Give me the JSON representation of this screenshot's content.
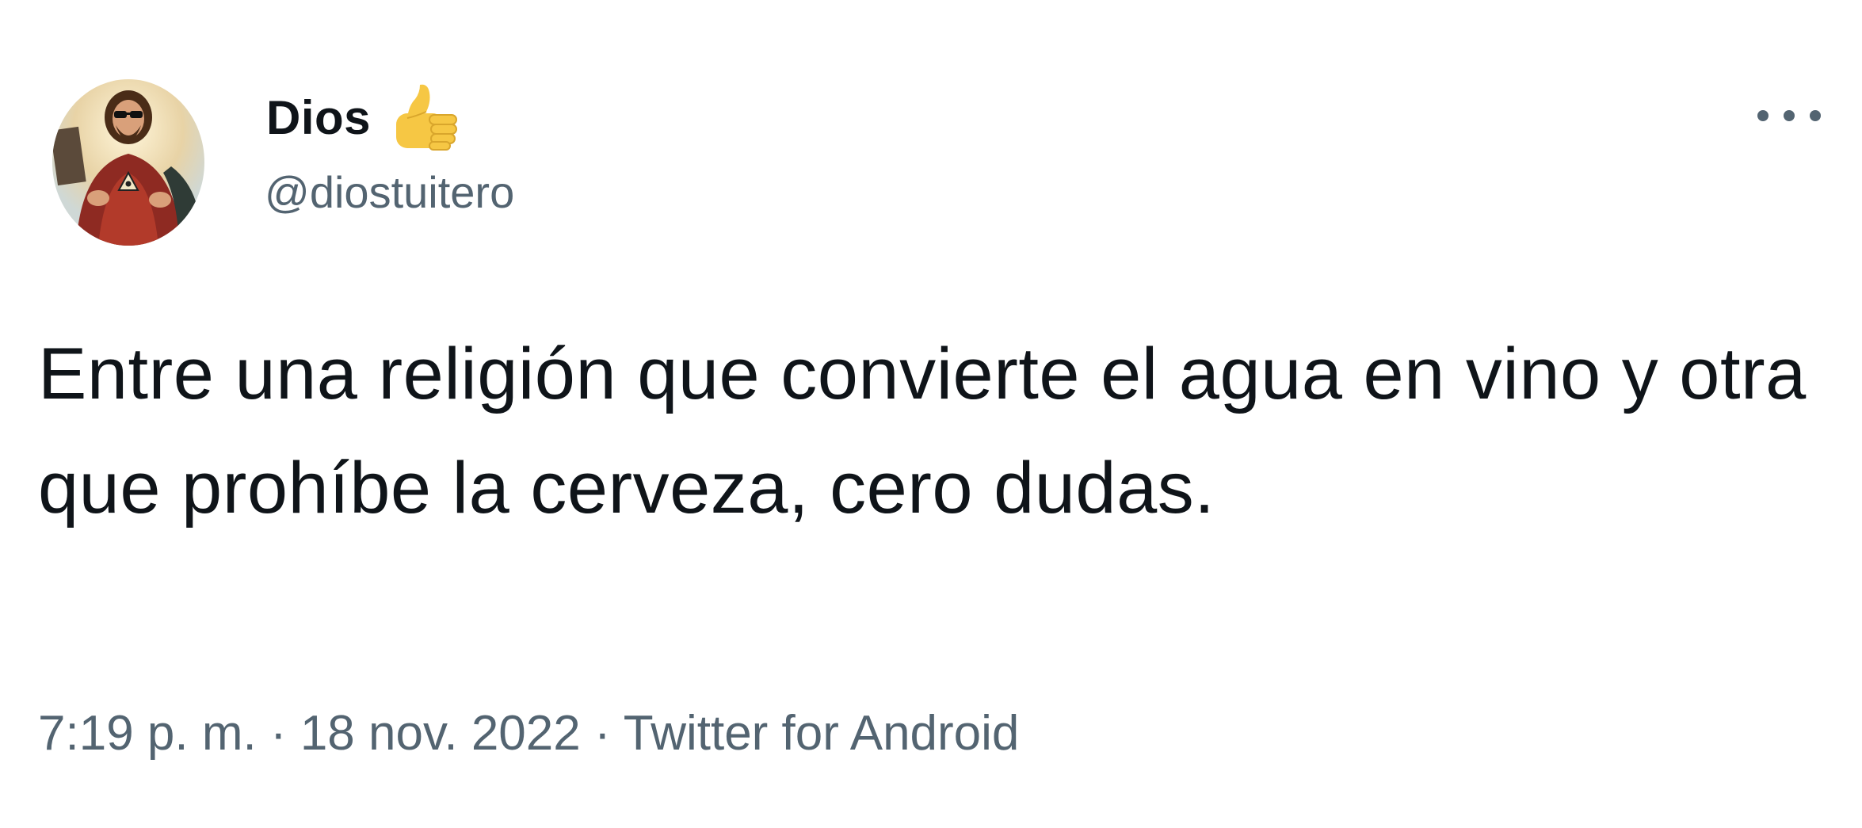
{
  "author": {
    "display_name": "Dios",
    "name_emoji_icon": "thumbs-up-icon",
    "handle": "@diostuitero",
    "avatar_icon": "sacred-heart-jesus-with-sunglasses-avatar"
  },
  "tweet": {
    "text": "Entre una religión que convierte el agua en vino y otra que prohíbe la cerveza, cero dudas."
  },
  "meta": {
    "time": "7:19 p. m.",
    "separator": "·",
    "date": "18 nov. 2022",
    "source": "Twitter for Android"
  },
  "actions": {
    "more_icon": "more-horizontal-icon"
  },
  "colors": {
    "text": "#0f1419",
    "secondary": "#536471",
    "background": "#ffffff"
  }
}
